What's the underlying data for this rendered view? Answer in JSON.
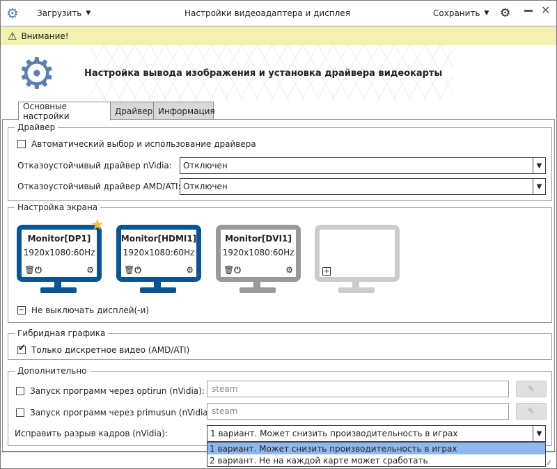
{
  "titlebar": {
    "title": "Настройки видеоадаптера и дисплея",
    "load_label": "Загрузить",
    "save_label": "Сохранить"
  },
  "warning": {
    "text": "Внимание!"
  },
  "header": {
    "title": "Настройка вывода изображения и установка драйвера видеокарты"
  },
  "tabs": [
    {
      "label": "Основные настройки",
      "active": true
    },
    {
      "label": "Драйвер"
    },
    {
      "label": "Информация"
    }
  ],
  "driver": {
    "legend": "Драйвер",
    "auto_label": "Автоматический выбор и использование драйвера",
    "auto_checked": false,
    "nvidia_label": "Отказоустойчивый драйвер nVidia:",
    "nvidia_value": "Отключен",
    "amd_label": "Отказоустойчивый драйвер AMD/ATI:",
    "amd_value": "Отключен"
  },
  "screen": {
    "legend": "Настройка экрана",
    "monitors": [
      {
        "name": "Monitor[DP1]",
        "mode": "1920x1080:60Hz",
        "color": "#0a5494",
        "primary": true
      },
      {
        "name": "Monitor[HDMI1]",
        "mode": "1920x1080:60Hz",
        "color": "#0a5494"
      },
      {
        "name": "Monitor[DVI1]",
        "mode": "1920x1080:60Hz",
        "color": "#999999"
      },
      {
        "name": "",
        "mode": "",
        "color": "#cccccc",
        "add": true
      }
    ],
    "keep_on_label": "Не выключать дисплей(-и)"
  },
  "hybrid": {
    "legend": "Гибридная графика",
    "discrete_label": "Только дискретное видео (AMD/ATI)",
    "discrete_checked": true
  },
  "extra": {
    "legend": "Дополнительно",
    "optirun_label": "Запуск программ через optirun (nVidia):",
    "optirun_value": "steam",
    "primusun_label": "Запуск программ через primusun (nVidia):",
    "primusun_value": "steam",
    "tearing_label": "Исправить разрыв кадров (nVidia):",
    "tearing_value": "1 вариант. Может снизить производительность в играх",
    "tearing_options": [
      "1 вариант. Может снизить производительность в играх",
      "2 вариант. Не на каждой карте может сработать"
    ]
  },
  "colors": {
    "accent": "#0a5494",
    "warning_bg": "#f3f0b0",
    "gear": "#5a7fb0",
    "star": "#f3c030",
    "selection": "#8fb8ee"
  }
}
